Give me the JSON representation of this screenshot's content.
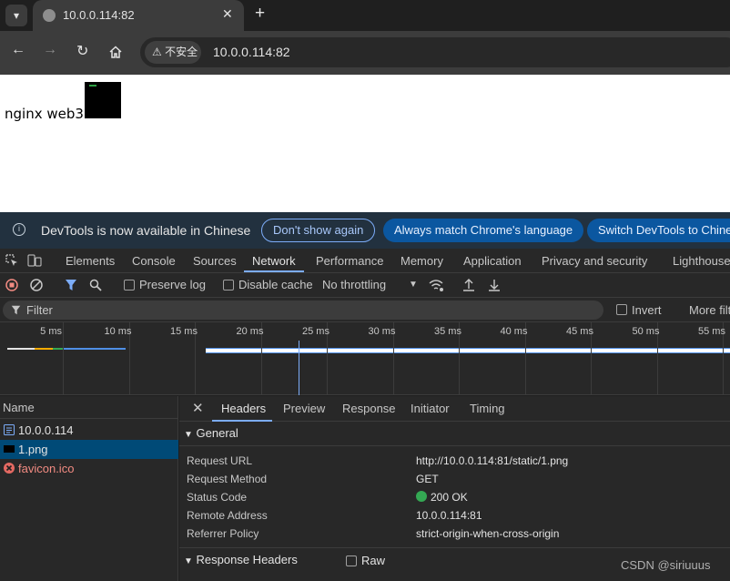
{
  "browser": {
    "tab_title": "10.0.0.114:82",
    "security_label": "不安全",
    "url": "10.0.0.114:82"
  },
  "page": {
    "text": "nginx web3"
  },
  "infobar": {
    "message": "DevTools is now available in Chinese",
    "dont_show": "Don't show again",
    "always_match": "Always match Chrome's language",
    "switch": "Switch DevTools to Chinese"
  },
  "devtools": {
    "tabs": [
      "Elements",
      "Console",
      "Sources",
      "Network",
      "Performance",
      "Memory",
      "Application",
      "Privacy and security",
      "Lighthouse"
    ],
    "active_tab": "Network",
    "preserve_log": "Preserve log",
    "disable_cache": "Disable cache",
    "throttling": "No throttling",
    "filter_placeholder": "Filter",
    "invert": "Invert",
    "more_filters": "More filters"
  },
  "timeline": {
    "ticks": [
      "5 ms",
      "10 ms",
      "15 ms",
      "20 ms",
      "25 ms",
      "30 ms",
      "35 ms",
      "40 ms",
      "45 ms",
      "50 ms",
      "55 ms"
    ]
  },
  "requests": {
    "header": "Name",
    "items": [
      {
        "name": "10.0.0.114",
        "type": "document",
        "color": "#e3e3e3"
      },
      {
        "name": "1.png",
        "type": "image",
        "color": "#e3e3e3"
      },
      {
        "name": "favicon.ico",
        "type": "error",
        "color": "#f28b82"
      }
    ],
    "selected": 1
  },
  "details": {
    "tabs": [
      "Headers",
      "Preview",
      "Response",
      "Initiator",
      "Timing"
    ],
    "active_tab": "Headers",
    "general_title": "General",
    "general": [
      {
        "key": "Request URL",
        "value": "http://10.0.0.114:81/static/1.png"
      },
      {
        "key": "Request Method",
        "value": "GET"
      },
      {
        "key": "Status Code",
        "value": "200 OK"
      },
      {
        "key": "Remote Address",
        "value": "10.0.0.114:81"
      },
      {
        "key": "Referrer Policy",
        "value": "strict-origin-when-cross-origin"
      }
    ],
    "response_headers_title": "Response Headers",
    "raw_label": "Raw"
  },
  "watermark": "CSDN @siriuuus",
  "colors": {
    "accent": "#7cacf8",
    "status_ok": "#34a853",
    "error": "#f28b82"
  }
}
